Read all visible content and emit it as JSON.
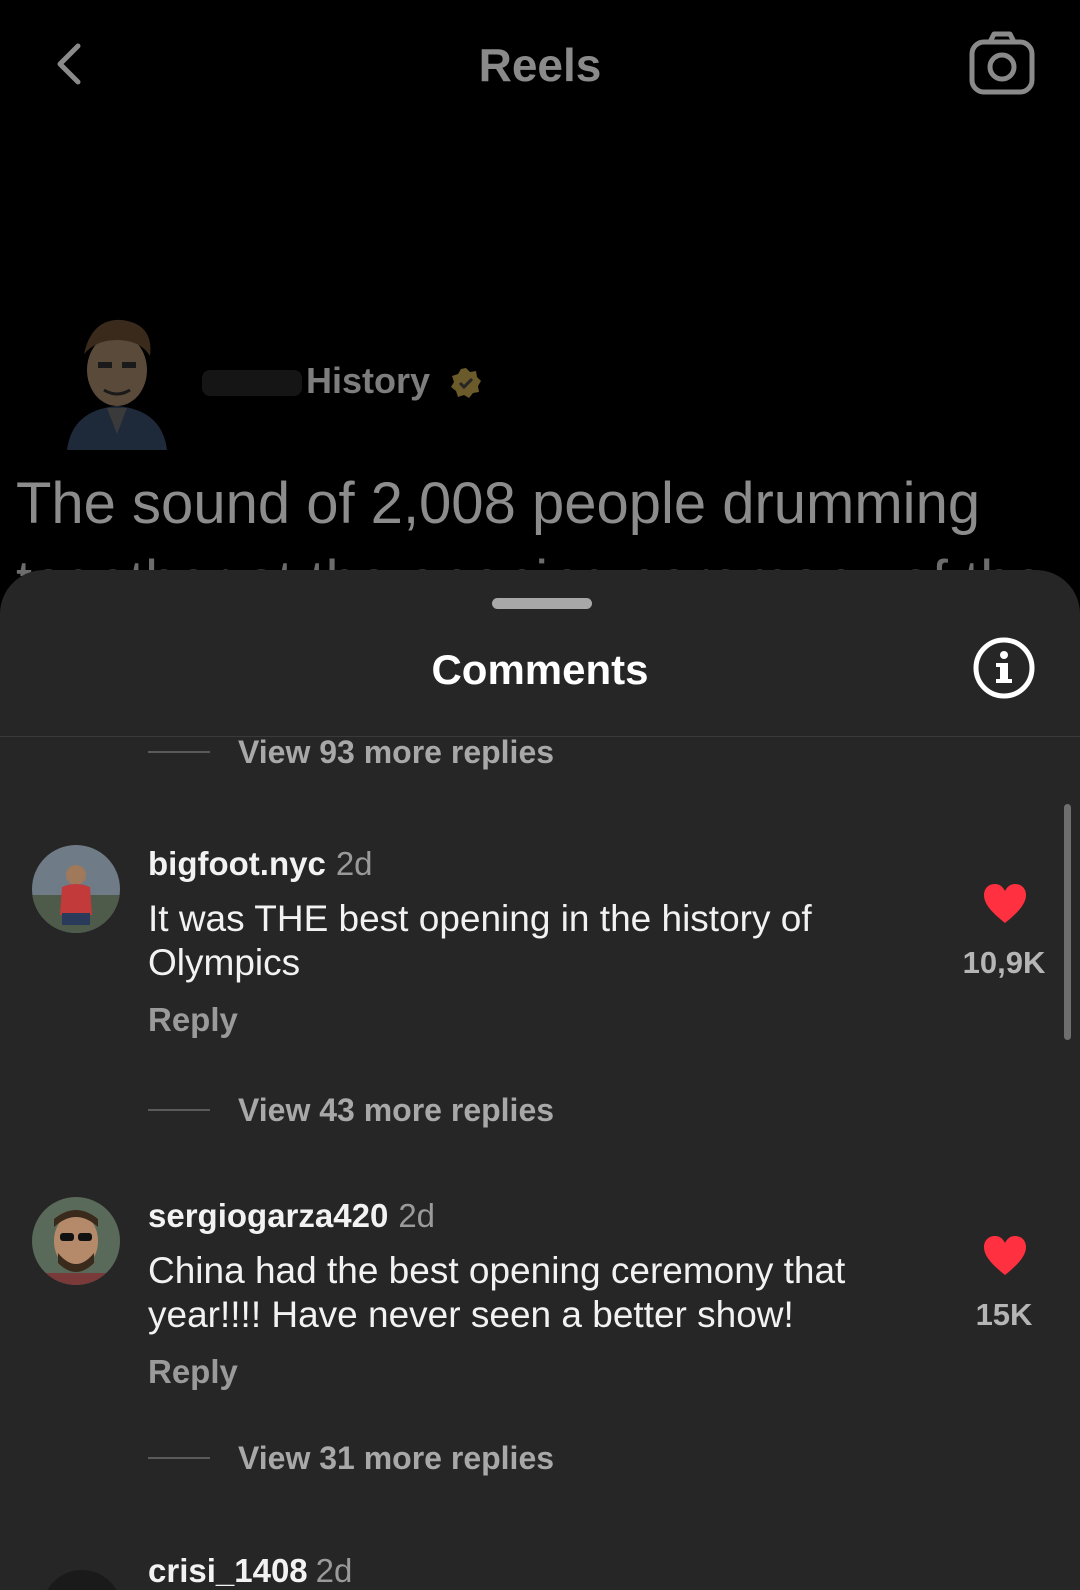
{
  "header": {
    "title": "Reels",
    "back_icon": "chevron-left-icon",
    "camera_icon": "camera-icon"
  },
  "author": {
    "name": "History",
    "verified_icon": "verified-badge-icon"
  },
  "caption": {
    "line1": "The sound of 2,008 people drumming",
    "line2": "together at the opening ceremony of the"
  },
  "sheet": {
    "title": "Comments",
    "info_icon": "info-icon",
    "replies_top": "View 93 more replies",
    "comments": [
      {
        "user": "bigfoot.nyc",
        "time": "2d",
        "text": "It was THE best opening in the history of Olympics",
        "reply_label": "Reply",
        "likes": "10,9K",
        "liked": true,
        "replies_label": "View 43 more replies"
      },
      {
        "user": "sergiogarza420",
        "time": "2d",
        "text": "China had the best opening ceremony that year!!!! Have never seen a better show!",
        "reply_label": "Reply",
        "likes": "15K",
        "liked": true,
        "replies_label": "View 31 more replies"
      }
    ],
    "peek": {
      "user": "crisi_1408",
      "time": "2d"
    }
  },
  "colors": {
    "sheet_bg": "#262626",
    "heart": "#ff3040",
    "background": "#000000"
  }
}
